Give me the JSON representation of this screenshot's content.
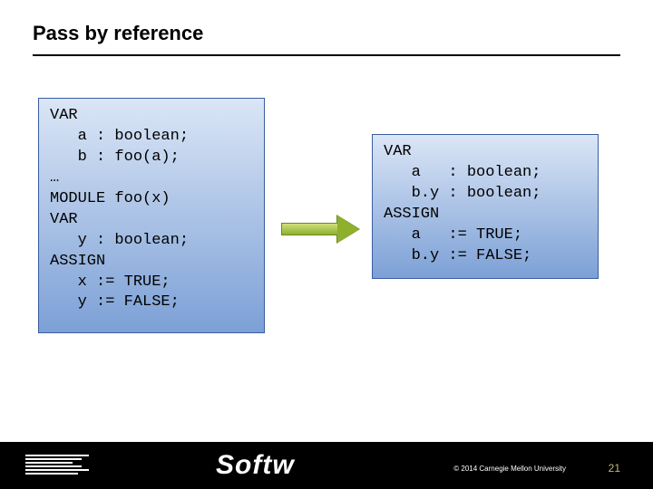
{
  "title": "Pass by reference",
  "code_left": "VAR\n   a : boolean;\n   b : foo(a);\n…\nMODULE foo(x)\nVAR\n   y : boolean;\nASSIGN\n   x := TRUE;\n   y := FALSE;",
  "code_right": "VAR\n   a   : boolean;\n   b.y : boolean;\nASSIGN\n   a   := TRUE;\n   b.y := FALSE;",
  "footer": {
    "brand": "Softw",
    "copyright": "© 2014 Carnegie Mellon University",
    "page_number": "21"
  }
}
